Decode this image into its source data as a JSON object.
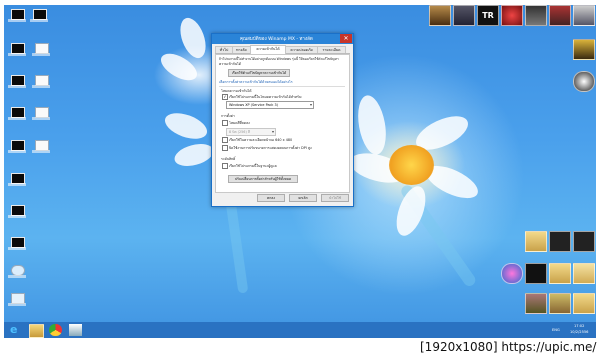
{
  "dialog": {
    "title": "คุณสมบัติของ Winamp MX - ทางลัด",
    "tabs": [
      "ทั่วไป",
      "ทางลัด",
      "ความเข้ากันได้",
      "ความปลอดภัย",
      "รายละเอียด"
    ],
    "active_tab": 2,
    "intro": "ถ้าโปรแกรมนี้ไม่ทำงานได้อย่างถูกต้องบน Windows รุ่นนี้ ให้ลองเรียกใช้ตัวแก้ไขปัญหา",
    "intro2": "ความเข้ากันได้",
    "troubleshooter_button": "เรียกใช้ตัวแก้ไขปัญหาความเข้ากันได้",
    "manual_link": "เลือกการตั้งค่าความเข้ากันได้ด้วยตนเองได้อย่างไร",
    "compat_mode_heading": "โหมดความเข้ากันได้",
    "compat_mode_checkbox": "เรียกใช้โปรแกรมนี้ในโหมดความเข้ากันได้สำหรับ:",
    "compat_mode_checked": true,
    "os_select": "Windows XP (Service Pack 3)",
    "settings_heading": "การตั้งค่า",
    "reduced_color": "โหมดสีที่ลดลง",
    "color_select": "8 บิต (256) สี",
    "resolution": "เรียกใช้ในความละเอียดหน้าจอ 640 x 480",
    "dpi": "ปิดใช้งานการปรับขนาดการแสดงผลบนการตั้งค่า DPI สูง",
    "privilege_heading": "ระดับสิทธิ์",
    "admin": "เรียกใช้โปรแกรมนี้ในฐานะผู้ดูแล",
    "all_users_button": "ปรับเปลี่ยนการตั้งค่าสำหรับผู้ใช้ทั้งหมด",
    "ok": "ตกลง",
    "cancel": "ยกเลิก",
    "apply": "นำไปใช้"
  },
  "taskbar": {
    "time": "17:02",
    "date": "10/2/2556",
    "lang": "ENG"
  },
  "footer": "[1920x1080] https://upic.me/",
  "colors": {
    "titlebar": "#2a84d8",
    "taskbar": "#286ebe",
    "wallpaper": "#4aa0ec"
  }
}
